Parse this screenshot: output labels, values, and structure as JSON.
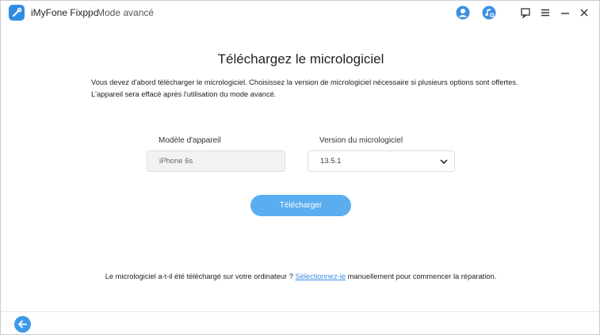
{
  "titlebar": {
    "app_name": "iMyFone Fixppo",
    "mode": "Mode avancé",
    "icons": [
      "user-icon",
      "music-search-icon",
      "feedback-icon",
      "menu-icon",
      "minimize-icon",
      "close-icon"
    ]
  },
  "main": {
    "title": "Téléchargez le micrologiciel",
    "description": "Vous devez d'abord télécharger le micrologiciel. Choisissez la version de micrologiciel nécessaire si plusieurs options sont offertes. L'appareil sera effacé après l'utilisation du mode avancé.",
    "model_label": "Modèle d'appareil",
    "model_value": "iPhone 6s",
    "version_label": "Version du micrologiciel",
    "version_value": "13.5.1",
    "download_button": "Télécharger"
  },
  "footer": {
    "note_before": "Le micrologiciel a-t-il été téléchargé sur votre ordinateur ?",
    "note_link": "Sélectionnez-le",
    "note_after": "manuellement pour commencer la réparation."
  },
  "colors": {
    "accent": "#5aaef0",
    "link": "#3a8ee6",
    "logo": "#2f8de4"
  }
}
